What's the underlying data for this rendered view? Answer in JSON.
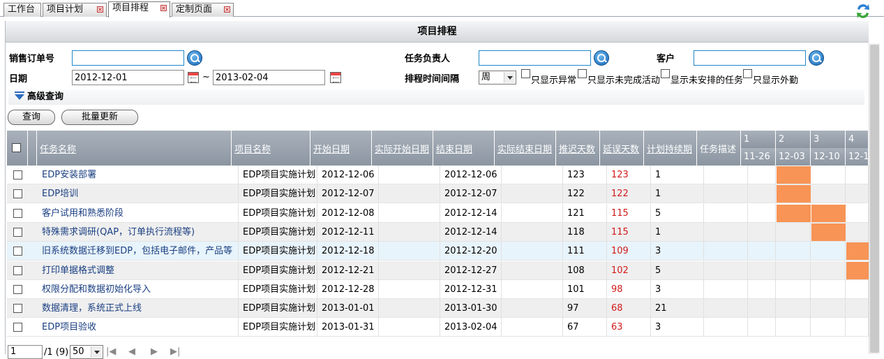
{
  "tabs": [
    {
      "label": "工作台",
      "closable": false
    },
    {
      "label": "项目计划",
      "closable": true
    },
    {
      "label": "项目排程",
      "closable": true,
      "active": true
    },
    {
      "label": "定制页面",
      "closable": true
    }
  ],
  "panel_title": "项目排程",
  "form": {
    "sales_order_label": "销售订单号",
    "sales_order_value": "",
    "owner_label": "任务负责人",
    "owner_value": "",
    "customer_label": "客户",
    "customer_value": "",
    "date_label": "日期",
    "date_from": "2012-12-01",
    "date_sep": "~",
    "date_to": "2013-02-04",
    "interval_label": "排程时间间隔",
    "interval_value": "周",
    "checks": [
      "只显示异常",
      "只显示未完成活动",
      "显示未安排的任务",
      "只显示外勤"
    ],
    "advanced_label": "高级查询",
    "query_button": "查询",
    "batch_button": "批量更新"
  },
  "grid": {
    "headers": [
      "任务名称",
      "项目名称",
      "开始日期",
      "实际开始日期",
      "结束日期",
      "实际结束日期",
      "推迟天数",
      "延误天数",
      "计划持续期",
      "任务描述"
    ],
    "weeks": [
      {
        "num": "1",
        "date": "11-26"
      },
      {
        "num": "2",
        "date": "12-03"
      },
      {
        "num": "3",
        "date": "12-10"
      },
      {
        "num": "4",
        "date": "12-1"
      }
    ],
    "rows": [
      {
        "task": "EDP安装部署",
        "project": "EDP项目实施计划",
        "start": "2012-12-06",
        "end": "2012-12-06",
        "delay": "123",
        "late": "123",
        "dur": "1",
        "bars": [
          1
        ]
      },
      {
        "task": "EDP培训",
        "project": "EDP项目实施计划",
        "start": "2012-12-07",
        "end": "2012-12-07",
        "delay": "122",
        "late": "122",
        "dur": "1",
        "bars": [
          1
        ]
      },
      {
        "task": "客户试用和熟悉阶段",
        "project": "EDP项目实施计划",
        "start": "2012-12-08",
        "end": "2012-12-14",
        "delay": "121",
        "late": "115",
        "dur": "5",
        "bars": [
          1,
          2
        ]
      },
      {
        "task": "特殊需求调研(QAP，订单执行流程等)",
        "project": "EDP项目实施计划",
        "start": "2012-12-11",
        "end": "2012-12-14",
        "delay": "118",
        "late": "115",
        "dur": "1",
        "bars": [
          2
        ]
      },
      {
        "task": "旧系统数据迁移到EDP，包括电子邮件，产品等",
        "project": "EDP项目实施计划",
        "start": "2012-12-18",
        "end": "2012-12-20",
        "delay": "111",
        "late": "109",
        "dur": "3",
        "bars": [
          3
        ]
      },
      {
        "task": "打印单据格式调整",
        "project": "EDP项目实施计划",
        "start": "2012-12-21",
        "end": "2012-12-27",
        "delay": "108",
        "late": "102",
        "dur": "5",
        "bars": [
          3
        ]
      },
      {
        "task": "权限分配和数据初始化导入",
        "project": "EDP项目实施计划",
        "start": "2012-12-28",
        "end": "2012-12-31",
        "delay": "101",
        "late": "98",
        "dur": "3",
        "bars": []
      },
      {
        "task": "数据清理，系统正式上线",
        "project": "EDP项目实施计划",
        "start": "2013-01-01",
        "end": "2013-01-30",
        "delay": "97",
        "late": "68",
        "dur": "21",
        "bars": []
      },
      {
        "task": "EDP项目验收",
        "project": "EDP项目实施计划",
        "start": "2013-01-31",
        "end": "2013-02-04",
        "delay": "67",
        "late": "63",
        "dur": "3",
        "bars": []
      }
    ]
  },
  "pager": {
    "page": "1",
    "total": "/1 (9)",
    "size": "50"
  },
  "colors": {
    "gantt": "#f79456",
    "late": "#d21a1a",
    "link": "#1a3f82"
  }
}
